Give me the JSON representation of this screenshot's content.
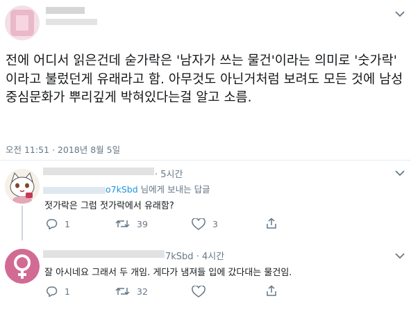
{
  "main_tweet": {
    "text": "전에 어디서 읽은건데 숟가락은 '남자가 쓰는 물건'이라는 의미로 '숫가락' 이라고 불렀던게 유래라고 함. 아무것도 아닌거처럼 보려도 모든 것에 남성중심문화가 뿌리깊게 박혀있다는걸 알고 소름.",
    "timestamp": "오전 11:51 · 2018년 8월 5일",
    "menu_icon": "chevron-down-icon"
  },
  "replies": [
    {
      "time": "· 5시간",
      "replying_to_handle": "o7kSbd",
      "replying_suffix": " 님에게 보내는 답글",
      "text": "젓가락은  그럼  젓가락에서 유래함?",
      "reply_count": "1",
      "retweet_count": "39",
      "like_count": "3",
      "avatar_icon": "cat-avatar-icon"
    },
    {
      "handle_suffix": "7kSbd",
      "time": "· 4시간",
      "text": "잘 아시네요 그래서 두 개임. 게다가 냄져들 입에 갔다대는 물건임.",
      "reply_count": "1",
      "retweet_count": "32",
      "like_count": "",
      "avatar_icon": "female-symbol-icon",
      "colors": {
        "avatar_bg": "#d26b93"
      }
    }
  ],
  "icons": [
    "reply-icon",
    "retweet-icon",
    "like-icon",
    "share-icon"
  ]
}
